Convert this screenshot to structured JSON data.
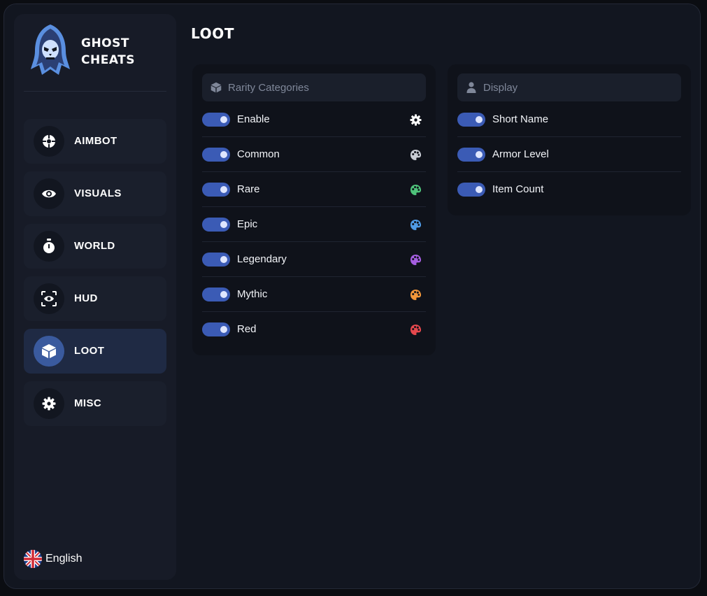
{
  "brand": {
    "name": "GHOST\nCHEATS",
    "logo_icon": "hooded-skull-icon"
  },
  "nav": {
    "items": [
      {
        "label": "AIMBOT",
        "icon": "crosshair-icon",
        "active": false
      },
      {
        "label": "VISUALS",
        "icon": "eye-icon",
        "active": false
      },
      {
        "label": "WORLD",
        "icon": "stopwatch-icon",
        "active": false
      },
      {
        "label": "HUD",
        "icon": "scan-eye-icon",
        "active": false
      },
      {
        "label": "LOOT",
        "icon": "box-icon",
        "active": true
      },
      {
        "label": "MISC",
        "icon": "gear-icon",
        "active": false
      }
    ]
  },
  "language": {
    "label": "English",
    "flag": "uk-flag-icon"
  },
  "page": {
    "title": "LOOT"
  },
  "rarity_panel": {
    "header": "Rarity Categories",
    "header_icon": "box-icon",
    "rows": [
      {
        "label": "Enable",
        "enabled": true,
        "icon": "gear-icon",
        "icon_color": "#ffffff"
      },
      {
        "label": "Common",
        "enabled": true,
        "icon": "palette-icon",
        "icon_color": "#c8ccd4"
      },
      {
        "label": "Rare",
        "enabled": true,
        "icon": "palette-icon",
        "icon_color": "#4ec27a"
      },
      {
        "label": "Epic",
        "enabled": true,
        "icon": "palette-icon",
        "icon_color": "#4f9be6"
      },
      {
        "label": "Legendary",
        "enabled": true,
        "icon": "palette-icon",
        "icon_color": "#a55ee0"
      },
      {
        "label": "Mythic",
        "enabled": true,
        "icon": "palette-icon",
        "icon_color": "#f2973a"
      },
      {
        "label": "Red",
        "enabled": true,
        "icon": "palette-icon",
        "icon_color": "#e5484d"
      }
    ]
  },
  "display_panel": {
    "header": "Display",
    "header_icon": "user-icon",
    "rows": [
      {
        "label": "Short Name",
        "enabled": true
      },
      {
        "label": "Armor Level",
        "enabled": true
      },
      {
        "label": "Item Count",
        "enabled": true
      }
    ]
  },
  "colors": {
    "accent": "#3b5bb5",
    "active_nav": "#1f2a44"
  }
}
